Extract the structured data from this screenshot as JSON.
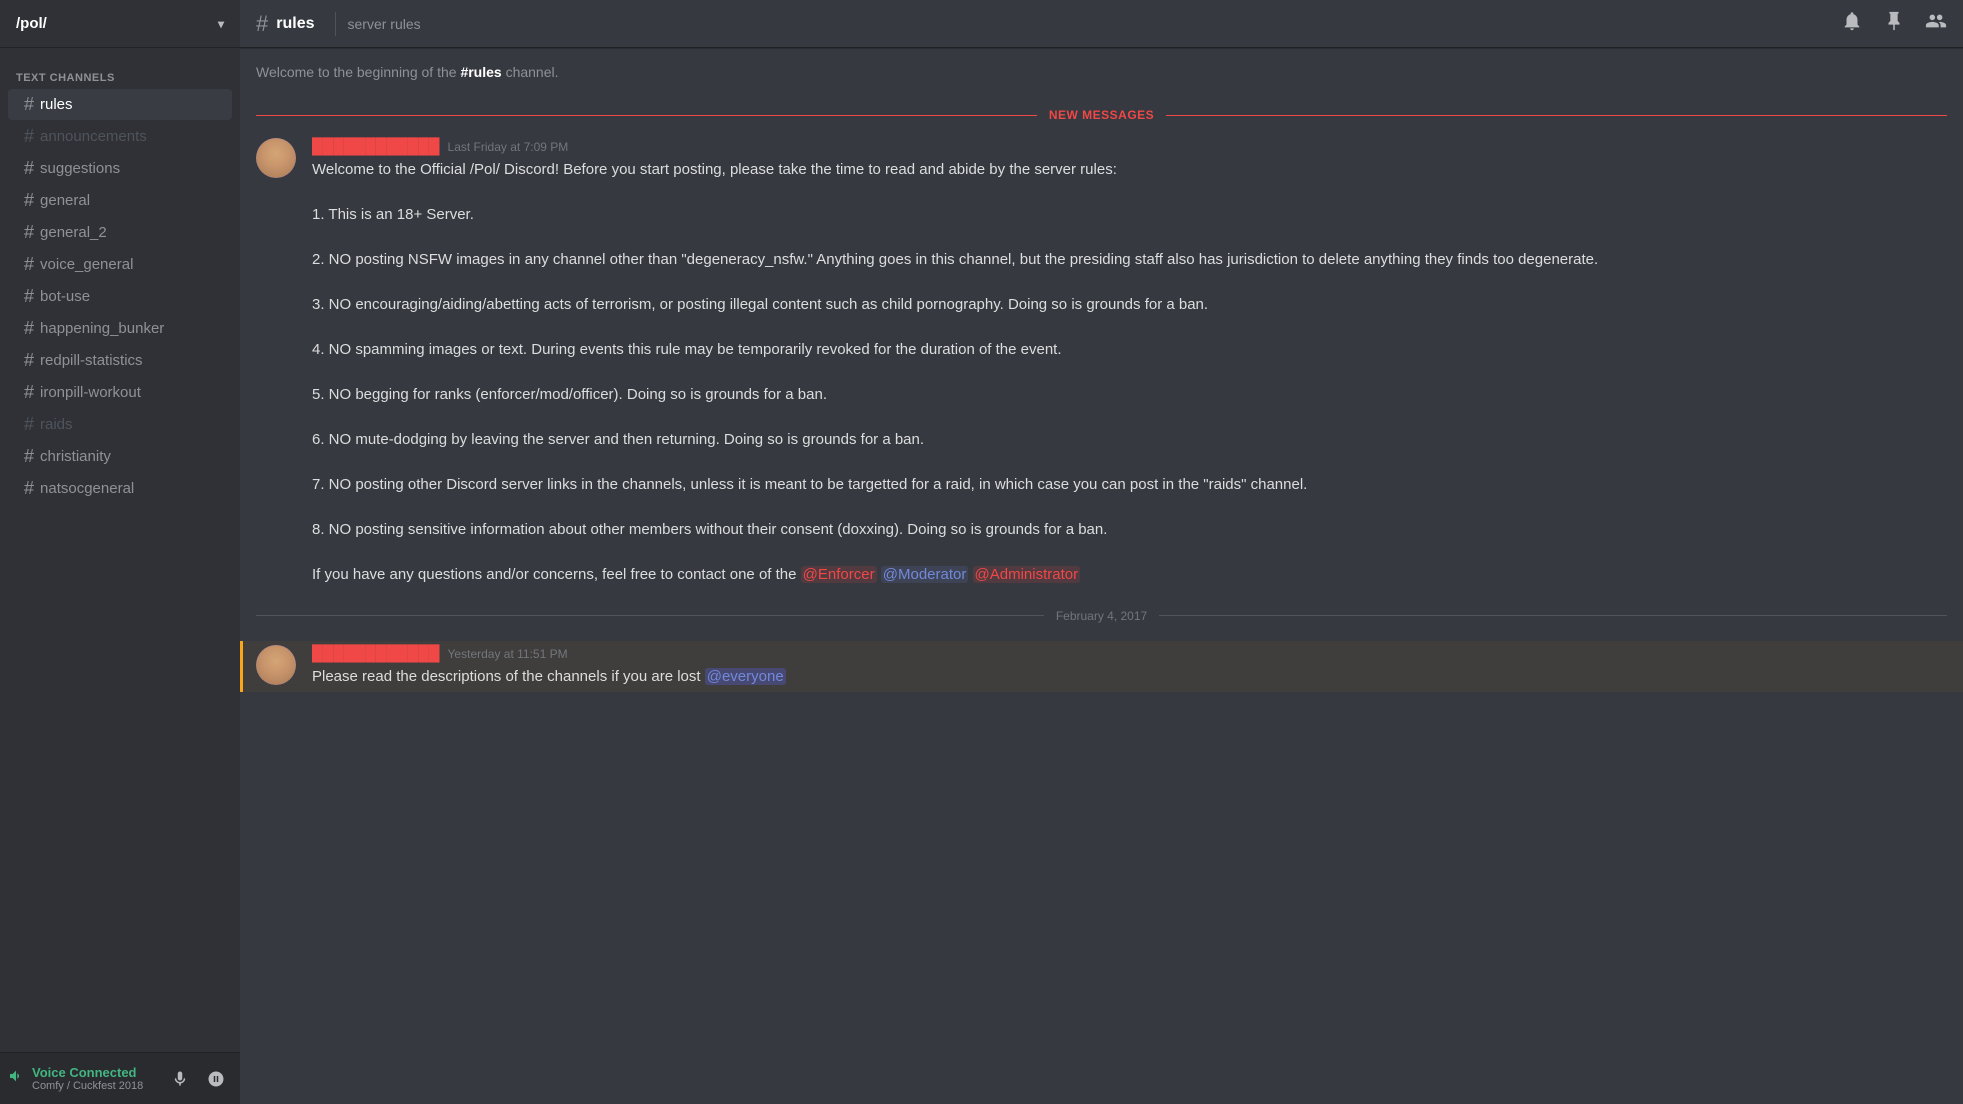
{
  "server": {
    "name": "/pol/",
    "chevron": "▾"
  },
  "sidebar": {
    "section_title": "TEXT CHANNELS",
    "channels": [
      {
        "name": "rules",
        "active": true,
        "muted": false
      },
      {
        "name": "announcements",
        "active": false,
        "muted": true
      },
      {
        "name": "suggestions",
        "active": false,
        "muted": false
      },
      {
        "name": "general",
        "active": false,
        "muted": false
      },
      {
        "name": "general_2",
        "active": false,
        "muted": false
      },
      {
        "name": "voice_general",
        "active": false,
        "muted": false
      },
      {
        "name": "bot-use",
        "active": false,
        "muted": false
      },
      {
        "name": "happening_bunker",
        "active": false,
        "muted": false
      },
      {
        "name": "redpill-statistics",
        "active": false,
        "muted": false
      },
      {
        "name": "ironpill-workout",
        "active": false,
        "muted": false
      },
      {
        "name": "raids",
        "active": false,
        "muted": true
      },
      {
        "name": "christianity",
        "active": false,
        "muted": false
      },
      {
        "name": "natsocgeneral",
        "active": false,
        "muted": false
      }
    ],
    "voice_connected": {
      "status": "Voice Connected",
      "channel": "Comfy / Cuckfest 2018"
    }
  },
  "channel_header": {
    "name": "rules",
    "topic": "server rules"
  },
  "messages": {
    "beginning_text_pre": "Welcome to the beginning of the ",
    "beginning_channel": "#rules",
    "beginning_text_post": " channel.",
    "new_messages_label": "NEW MESSAGES",
    "message1": {
      "author": "redacted username",
      "timestamp": "Last Friday at 7:09 PM",
      "lines": [
        "Welcome to the Official /Pol/ Discord! Before you start posting, please take the time to read and abide by the server rules:",
        "",
        "1. This is an 18+ Server.",
        "",
        "2. NO posting NSFW images in any channel other than \"degeneracy_nsfw.\" Anything goes in this channel, but the presiding staff also has jurisdiction to delete anything they finds too degenerate.",
        "",
        "3. NO encouraging/aiding/abetting acts of terrorism, or posting illegal content such as child pornography. Doing so is grounds for a ban.",
        "",
        "4. NO spamming images or text. During events this rule may be temporarily revoked for the duration of the event.",
        "",
        "5. NO begging for ranks (enforcer/mod/officer). Doing so is grounds for a ban.",
        "",
        "6. NO mute-dodging by leaving the server and then returning. Doing so is grounds for a ban.",
        "",
        "7. NO posting other Discord server links in the channels, unless it is meant to be targetted for a raid, in which case you can post in the \"raids\" channel.",
        "",
        "8. NO posting sensitive information about other members without their consent (doxxing). Doing so is grounds for a ban.",
        "",
        "If you have any questions and/or concerns, feel free to contact one of the "
      ],
      "mention_enforcer": "@Enforcer",
      "mention_moderator": "@Moderator",
      "mention_admin": "@Administrator"
    },
    "date_divider": "February 4, 2017",
    "message2": {
      "author": "redacted username",
      "timestamp": "Yesterday at 11:51 PM",
      "text": "Please read the descriptions of the channels if you are lost ",
      "mention_everyone": "@everyone"
    }
  },
  "icons": {
    "bell": "🔔",
    "pin": "📌",
    "person": "👤",
    "hash": "#",
    "microphone": "🎤",
    "headphone": "🎧"
  }
}
